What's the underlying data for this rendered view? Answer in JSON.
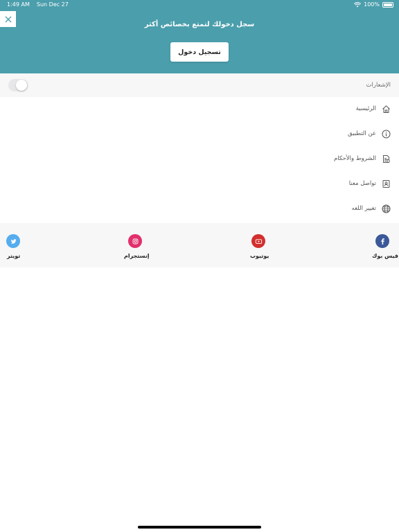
{
  "status": {
    "time": "1:49 AM",
    "date": "Sun Dec 27",
    "battery": "100%"
  },
  "header": {
    "message": "سجل دخولك لتمتع بخصائص أكثر",
    "login_label": "تسجيل دخول",
    "color": "#4b9eac"
  },
  "notifications": {
    "label": "الإشعارات",
    "enabled": false
  },
  "menu": {
    "items": [
      {
        "label": "الرئيسية",
        "icon": "home-icon"
      },
      {
        "label": "عن التطبيق",
        "icon": "info-icon"
      },
      {
        "label": "الشروط والأحكام",
        "icon": "document-icon"
      },
      {
        "label": "تواصل معنا",
        "icon": "contact-card-icon"
      },
      {
        "label": "تغيير اللغه",
        "icon": "globe-icon"
      }
    ]
  },
  "social": {
    "items": [
      {
        "label": "فيس بوك",
        "icon": "facebook-icon",
        "color": "#3b5998"
      },
      {
        "label": "يوتيوب",
        "icon": "youtube-icon",
        "color": "#d32f2f"
      },
      {
        "label": "إنستجرام",
        "icon": "instagram-icon",
        "color": "#e1306c"
      },
      {
        "label": "تويتر",
        "icon": "twitter-icon",
        "color": "#55acee"
      }
    ]
  }
}
